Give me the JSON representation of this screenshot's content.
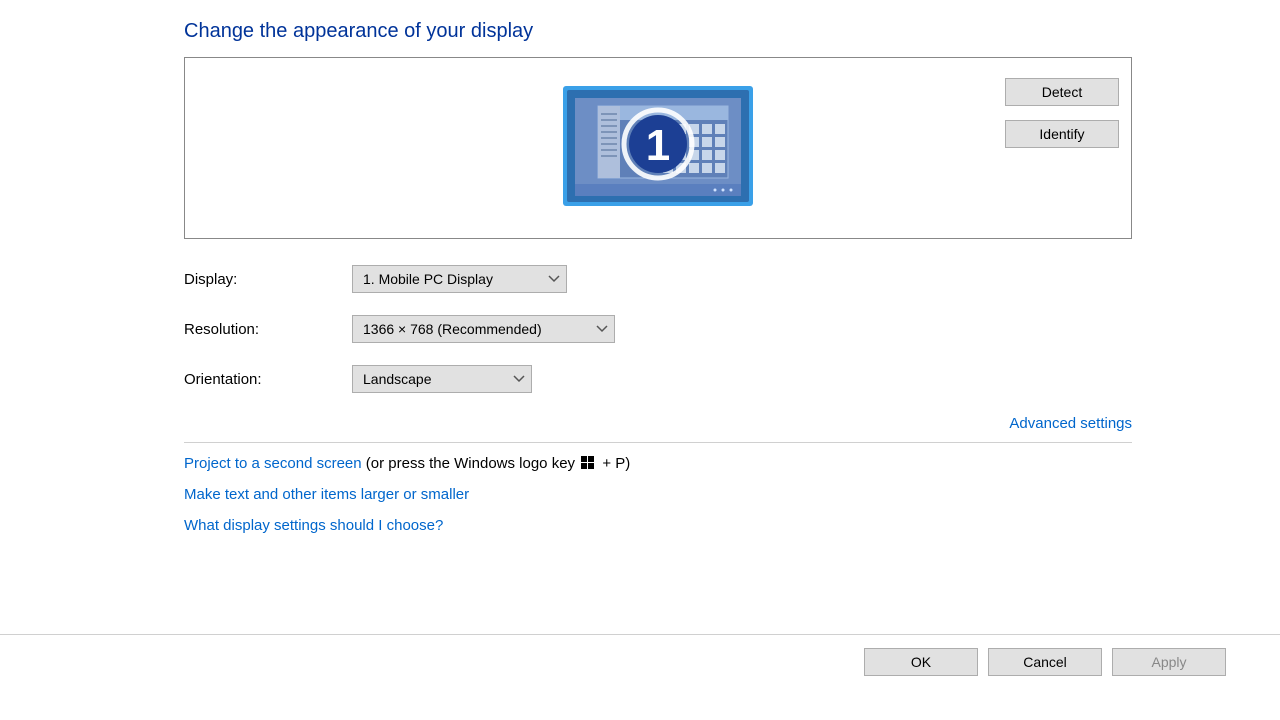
{
  "heading": "Change the appearance of your display",
  "preview": {
    "detect_label": "Detect",
    "identify_label": "Identify",
    "monitor_number": "1"
  },
  "form": {
    "display_label": "Display:",
    "display_value": "1. Mobile PC Display",
    "resolution_label": "Resolution:",
    "resolution_value": "1366 × 768 (Recommended)",
    "orientation_label": "Orientation:",
    "orientation_value": "Landscape"
  },
  "advanced_link": "Advanced settings",
  "links": {
    "project_link": "Project to a second screen",
    "project_hint_pre": " (or press the Windows logo key ",
    "project_hint_post": " + P)",
    "text_size": "Make text and other items larger or smaller",
    "which_settings": "What display settings should I choose?"
  },
  "footer": {
    "ok": "OK",
    "cancel": "Cancel",
    "apply": "Apply"
  }
}
